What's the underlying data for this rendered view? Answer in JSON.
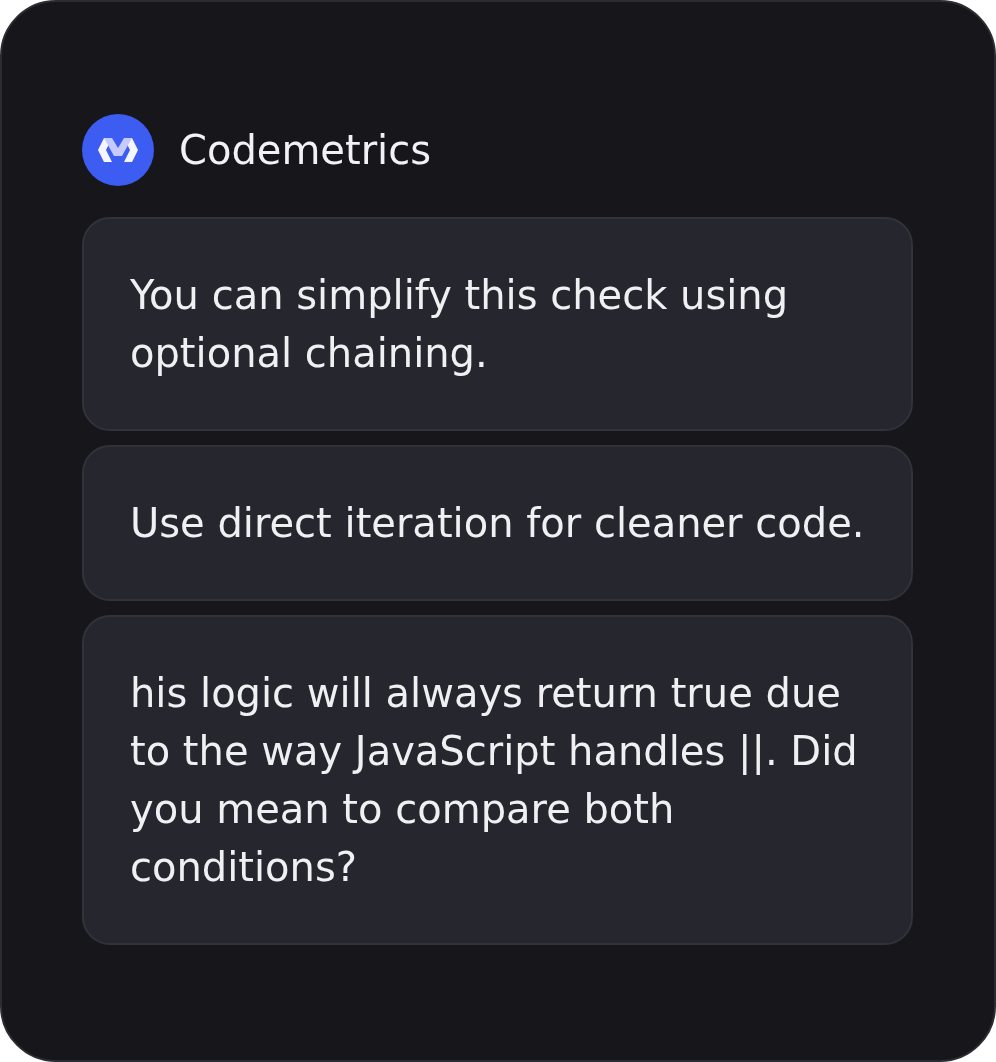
{
  "header": {
    "title": "Codemetrics"
  },
  "comments": [
    {
      "text": "You can simplify this check using optional chaining."
    },
    {
      "text": "Use direct iteration for cleaner code."
    },
    {
      "text": "his logic will always return true due to the way JavaScript handles ||. Did you mean to compare both conditions?"
    }
  ]
}
